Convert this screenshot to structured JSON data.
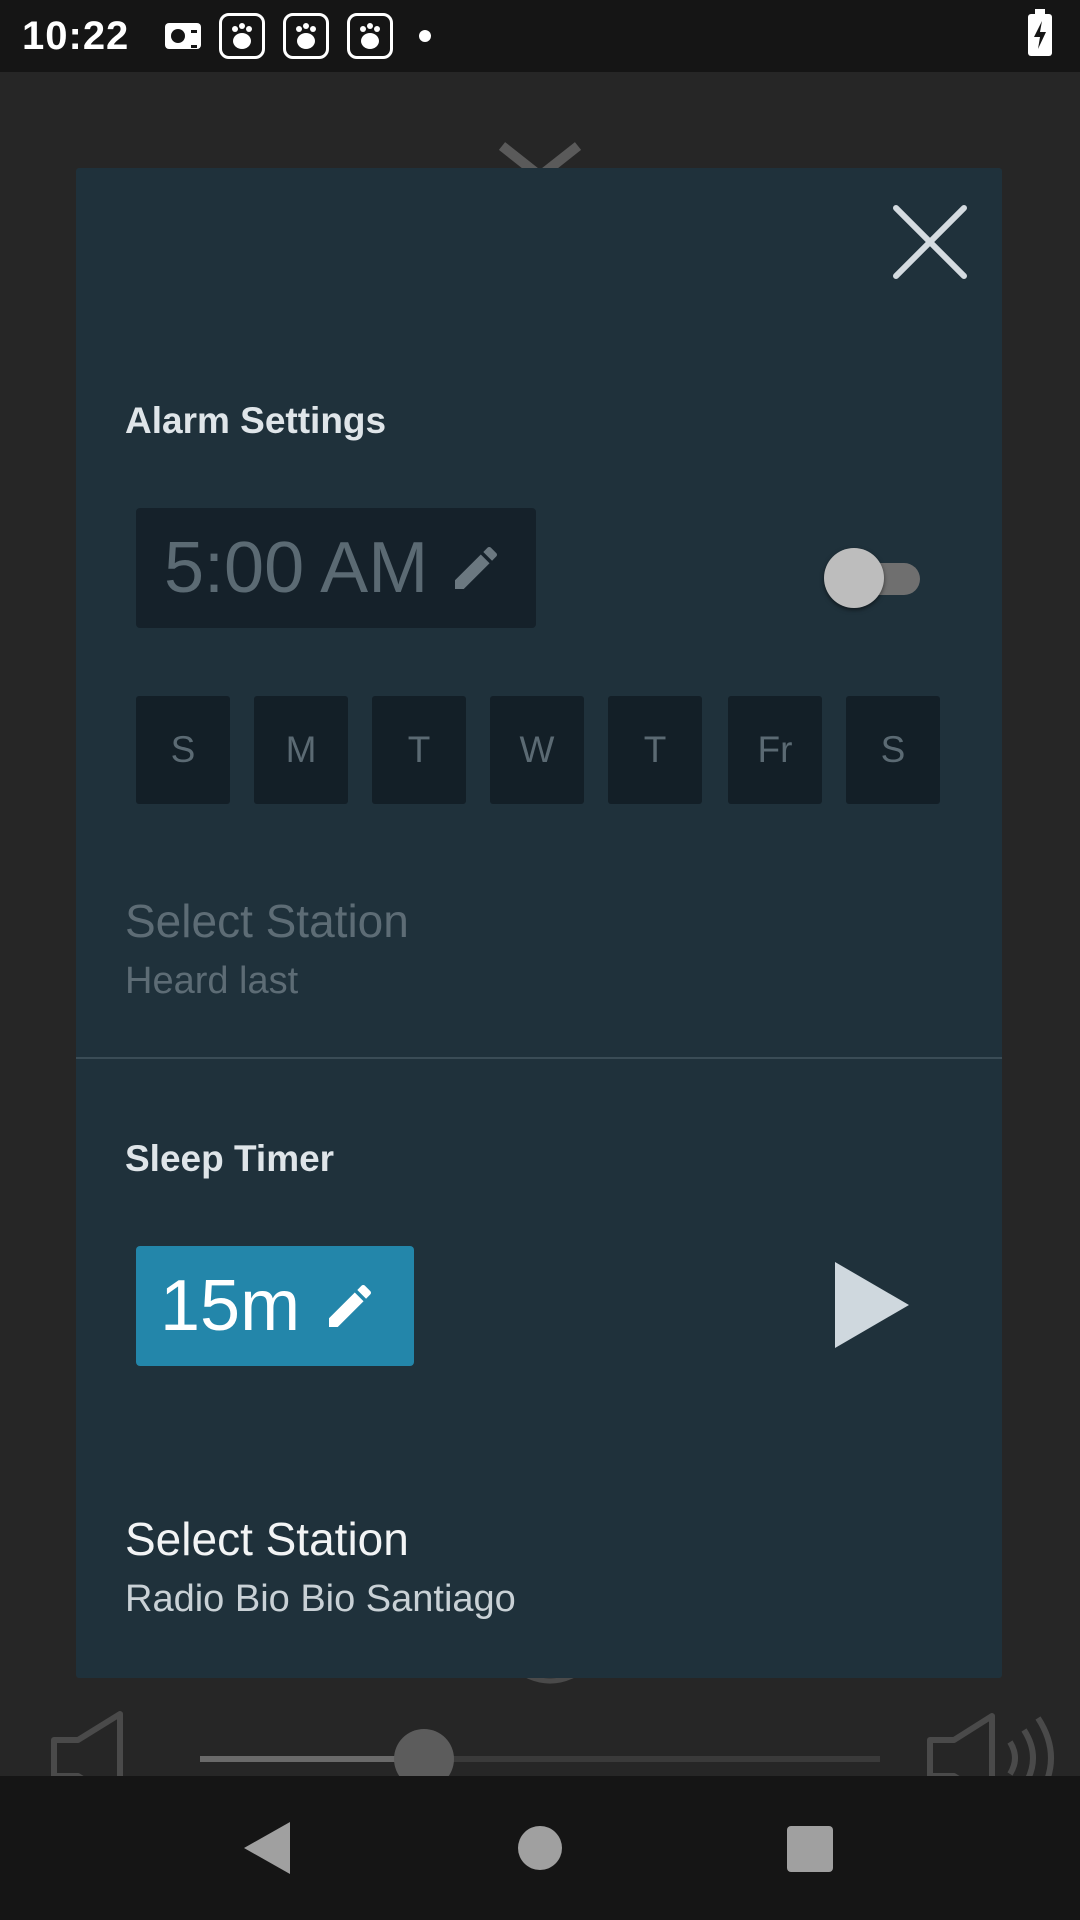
{
  "status_bar": {
    "time": "10:22",
    "notification_icons": [
      "radio-icon",
      "baidu-paw-icon",
      "baidu-paw-icon",
      "baidu-paw-icon",
      "dot-icon"
    ],
    "battery": "battery-charging-icon"
  },
  "dialog": {
    "alarm": {
      "title": "Alarm Settings",
      "time": "5:00 AM",
      "enabled": false,
      "days": [
        "S",
        "M",
        "T",
        "W",
        "T",
        "Fr",
        "S"
      ],
      "station_title": "Select Station",
      "station_subtitle": "Heard last"
    },
    "sleep": {
      "title": "Sleep Timer",
      "duration": "15m",
      "station_title": "Select Station",
      "station_subtitle": "Radio Bio Bio Santiago"
    }
  },
  "volume": {
    "level": 0.33
  },
  "colors": {
    "dialog_bg": "#1f313b",
    "timer_accent": "#2386aa",
    "disabled_text": "#5b6a73"
  }
}
